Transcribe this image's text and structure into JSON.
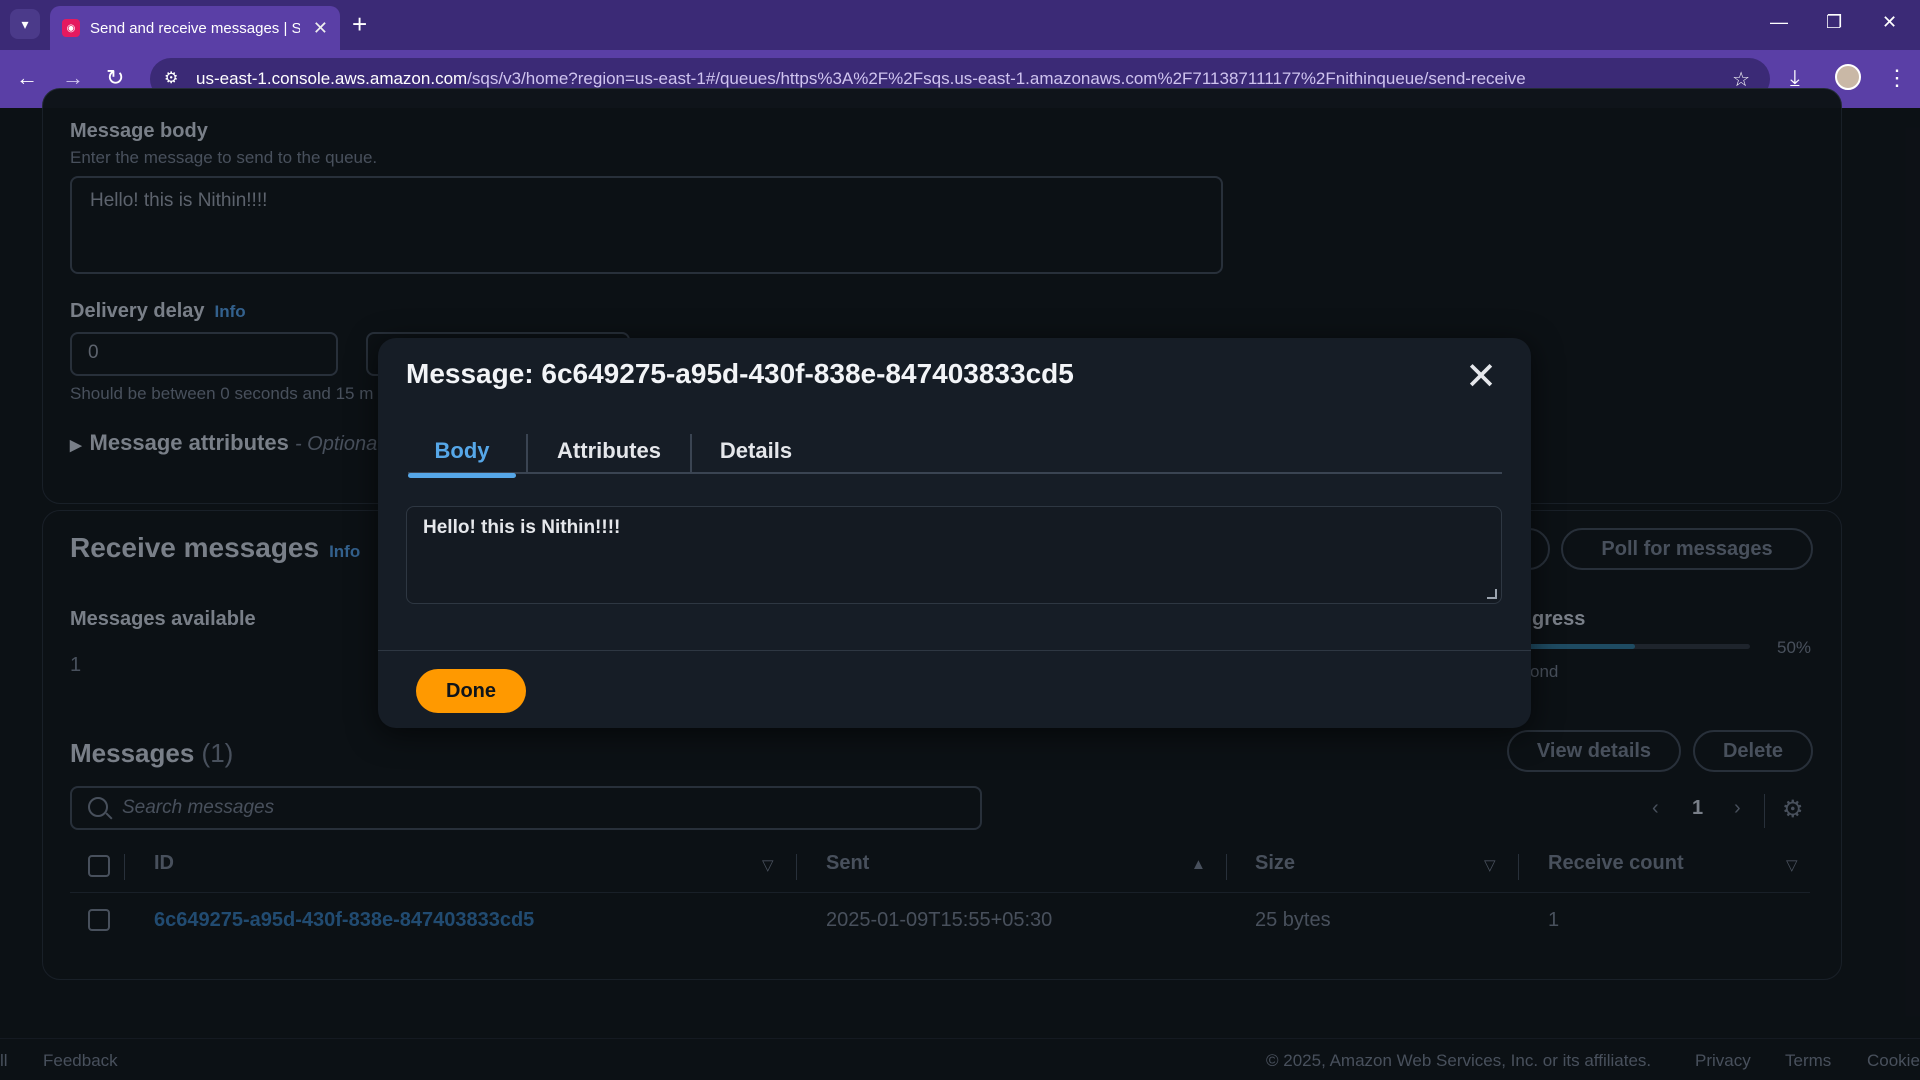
{
  "browser": {
    "tab_title": "Send and receive messages | Si",
    "tab_favicon": "sqs-favicon",
    "url_host": "us-east-1.console.aws.amazon.com",
    "url_path": "/sqs/v3/home?region=us-east-1#/queues/https%3A%2F%2Fsqs.us-east-1.amazonaws.com%2F711387111177%2Fnithinqueue/send-receive"
  },
  "send": {
    "message_body_label": "Message body",
    "message_body_desc": "Enter the message to send to the queue.",
    "message_body_value": "Hello! this is Nithin!!!!",
    "delivery_delay_label": "Delivery delay",
    "info_label": "Info",
    "delivery_delay_value": "0",
    "delivery_delay_hint": "Should be between 0 seconds and 15 m",
    "message_attributes_label": "Message attributes",
    "message_attributes_suffix": "- Optiona"
  },
  "receive": {
    "title": "Receive messages",
    "info_label": "Info",
    "poll_button": "Poll for messages",
    "messages_available_label": "Messages available",
    "messages_available_value": "1",
    "progress_label_fragment": "gress",
    "progress_percent": "50%",
    "progress_fraction": 0.5,
    "progress_sub_fragment": "ond"
  },
  "messages": {
    "title": "Messages",
    "count": "(1)",
    "view_details_button": "View details",
    "delete_button": "Delete",
    "search_placeholder": "Search messages",
    "page_number": "1",
    "columns": {
      "id": "ID",
      "sent": "Sent",
      "size": "Size",
      "receive_count": "Receive count"
    },
    "rows": [
      {
        "id": "6c649275-a95d-430f-838e-847403833cd5",
        "sent": "2025-01-09T15:55+05:30",
        "size": "25 bytes",
        "receive_count": "1"
      }
    ]
  },
  "footer": {
    "left_fragment": "ll",
    "feedback": "Feedback",
    "copyright": "© 2025, Amazon Web Services, Inc. or its affiliates.",
    "privacy": "Privacy",
    "terms": "Terms",
    "cookies": "Cookie"
  },
  "modal": {
    "title": "Message: 6c649275-a95d-430f-838e-847403833cd5",
    "tabs": [
      "Body",
      "Attributes",
      "Details"
    ],
    "active_tab": "Body",
    "body_value": "Hello! this is Nithin!!!!",
    "done_button": "Done"
  },
  "colors": {
    "chrome": "#5a3fa6",
    "accent_primary": "#ff9900",
    "tab_active": "#56a7e8",
    "link": "#2f6ea6"
  }
}
